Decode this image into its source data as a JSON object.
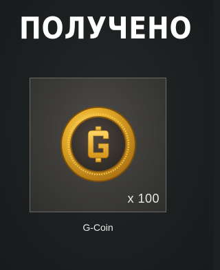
{
  "header": {
    "title": "ПОЛУЧЕНО"
  },
  "reward": {
    "icon": "g-coin-icon",
    "coin_letter": "G",
    "quantity_label": "x 100",
    "quantity": 100,
    "name": "G-Coin"
  },
  "colors": {
    "coin_gold": "#e0a823",
    "coin_dark_face": "#3b3530",
    "card_background": "#3e3d3a"
  }
}
